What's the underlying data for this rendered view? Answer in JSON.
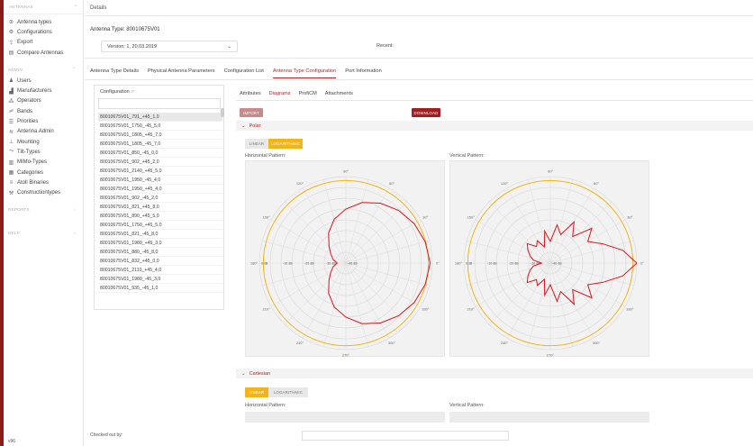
{
  "sidebar": {
    "header": "ANTENNAS",
    "items": [
      {
        "icon": "antenna-icon",
        "glyph": "⊛",
        "label": "Antenna types"
      },
      {
        "icon": "gear-icon",
        "glyph": "⚙",
        "label": "Configurations"
      },
      {
        "icon": "export-icon",
        "glyph": "⇪",
        "label": "Export"
      },
      {
        "icon": "compare-icon",
        "glyph": "▤",
        "label": "Compare Antennas"
      }
    ],
    "admin_header": "ADMIN",
    "admin_items": [
      {
        "icon": "users-icon",
        "glyph": "♟",
        "label": "Users"
      },
      {
        "icon": "factory-icon",
        "glyph": "▟",
        "label": "Manufacturers"
      },
      {
        "icon": "operators-icon",
        "glyph": "⁂",
        "label": "Operators"
      },
      {
        "icon": "bands-icon",
        "glyph": "≓",
        "label": "Bands"
      },
      {
        "icon": "priorities-icon",
        "glyph": "☰",
        "label": "Priorities"
      },
      {
        "icon": "wifi-icon",
        "glyph": "≋",
        "label": "Antenna Admin"
      },
      {
        "icon": "mounting-icon",
        "glyph": "⊥",
        "label": "Mounting"
      },
      {
        "icon": "tilt-icon",
        "glyph": "⤳",
        "label": "Tilt-Types"
      },
      {
        "icon": "mimo-icon",
        "glyph": "▥",
        "label": "MIMo-Types"
      },
      {
        "icon": "categories-icon",
        "glyph": "▦",
        "label": "Categories"
      },
      {
        "icon": "atoll-icon",
        "glyph": "≡",
        "label": "Atoll Binaries"
      },
      {
        "icon": "wrench-icon",
        "glyph": "⚒",
        "label": "Constructiontypes"
      }
    ],
    "reports_header": "REPORTS",
    "help_header": "HELP",
    "footer": "v96"
  },
  "topbar": {
    "title": "Details"
  },
  "antenna_type": "Antenna Type: 80010675V01",
  "version": {
    "selected": "Version: 1, 20.03.2019"
  },
  "recent_label": "Recent:",
  "tabs": [
    {
      "label": "Antenna Type Details",
      "active": false
    },
    {
      "label": "Physical Antenna Parameters",
      "active": false
    },
    {
      "label": "Configuration List",
      "active": false
    },
    {
      "label": "Antenna Type Configuration",
      "active": true
    },
    {
      "label": "Port Information",
      "active": false
    }
  ],
  "config": {
    "label": "Configuration",
    "required_mark": "2*",
    "items": [
      "80010675V01_791_+45_1,0",
      "80010675V01_1750_-45_5,0",
      "80010675V01_1805_+45_7,0",
      "80010675V01_1805_-45_7,0",
      "80010675V01_850_-45_0,0",
      "80010675V01_902_+45_2,0",
      "80010675V01_2140_+45_5,0",
      "80010675V01_1950_-45_4,0",
      "80010675V01_1950_+45_4,0",
      "80010675V01_902_-45_2,0",
      "80010675V01_821_+45_8,0",
      "80010675V01_890_+45_5,0",
      "80010675V01_1750_+45_5,0",
      "80010675V01_821_-45_8,0",
      "80010675V01_1980_+45_3,0",
      "80010675V01_880_-45_8,0",
      "80010675V01_832_+45_0,0",
      "80010675V01_2110_+45_4,0",
      "80010675V01_1980_-45_3,0",
      "80010675V01_935_-45_1,0"
    ]
  },
  "inner_tabs": [
    {
      "label": "Attributes",
      "active": false
    },
    {
      "label": "Diagrams",
      "active": true
    },
    {
      "label": "ProfiCM",
      "active": false
    },
    {
      "label": "Attachments",
      "active": false
    }
  ],
  "buttons": {
    "import": "IMPORT",
    "download": "DOWNLOAD"
  },
  "polar": {
    "title": "Polar",
    "toggle": {
      "linear": "LINEAR",
      "log": "LOGARITHMIC",
      "selected": "LOGARITHMIC"
    },
    "horizontal_label": "Horizontal Pattern:",
    "vertical_label": "Vertical Pattern:"
  },
  "chart_data": [
    {
      "type": "polar",
      "title": "Horizontal Pattern:",
      "angle_labels": [
        "0°",
        "30°",
        "60°",
        "90°",
        "120°",
        "150°",
        "180°",
        "210°",
        "240°",
        "270°",
        "300°",
        "330°"
      ],
      "radial_labels": [
        "0 dB",
        "-10 dB",
        "-20 dB",
        "-30 dB",
        "-40 dB"
      ],
      "series_color": "#d8141a",
      "limit_ring_color": "#f2b416",
      "series": [
        {
          "angles_deg": [
            0,
            15,
            30,
            45,
            60,
            75,
            90,
            105,
            120,
            135,
            150,
            165,
            180,
            195,
            210,
            225,
            240,
            255,
            270,
            285,
            300,
            315,
            330,
            345
          ],
          "gain_db": [
            -1,
            -2,
            -3.5,
            -5.5,
            -8,
            -11,
            -15,
            -19,
            -24,
            -29,
            -32,
            -34,
            -36,
            -34,
            -32,
            -29,
            -24,
            -19,
            -15,
            -11,
            -8,
            -5.5,
            -3.5,
            -2
          ]
        }
      ]
    },
    {
      "type": "polar",
      "title": "Vertical Pattern:",
      "angle_labels": [
        "0°",
        "30°",
        "60°",
        "90°",
        "120°",
        "150°",
        "180°",
        "210°",
        "240°",
        "270°",
        "300°",
        "330°"
      ],
      "radial_labels": [
        "0 dB",
        "-10 dB",
        "-20 dB",
        "-30 dB",
        "-40 dB"
      ],
      "series_color": "#d8141a",
      "limit_ring_color": "#f2b416",
      "series": [
        {
          "angles_deg": [
            0,
            10,
            20,
            30,
            40,
            50,
            60,
            70,
            80,
            90,
            100,
            110,
            120,
            130,
            140,
            150,
            160,
            170,
            180,
            190,
            200,
            210,
            220,
            230,
            240,
            250,
            260,
            270,
            280,
            290,
            300,
            310,
            320,
            330,
            340,
            350
          ],
          "gain_db": [
            0,
            -6,
            -14,
            -20,
            -15,
            -24,
            -18,
            -26,
            -22,
            -30,
            -25,
            -32,
            -28,
            -30,
            -26,
            -28,
            -30,
            -32,
            -36,
            -32,
            -30,
            -28,
            -26,
            -30,
            -28,
            -32,
            -25,
            -30,
            -22,
            -26,
            -18,
            -24,
            -15,
            -20,
            -14,
            -6
          ]
        }
      ]
    }
  ],
  "cartesian": {
    "title": "Cartesian",
    "toggle": {
      "linear": "LINEAR",
      "log": "LOGARITHMIC",
      "selected": "LINEAR"
    },
    "horizontal_label": "Horizontal Pattern:",
    "vertical_label": "Vertical Pattern:"
  },
  "checked_out_label": "Checked out by:"
}
